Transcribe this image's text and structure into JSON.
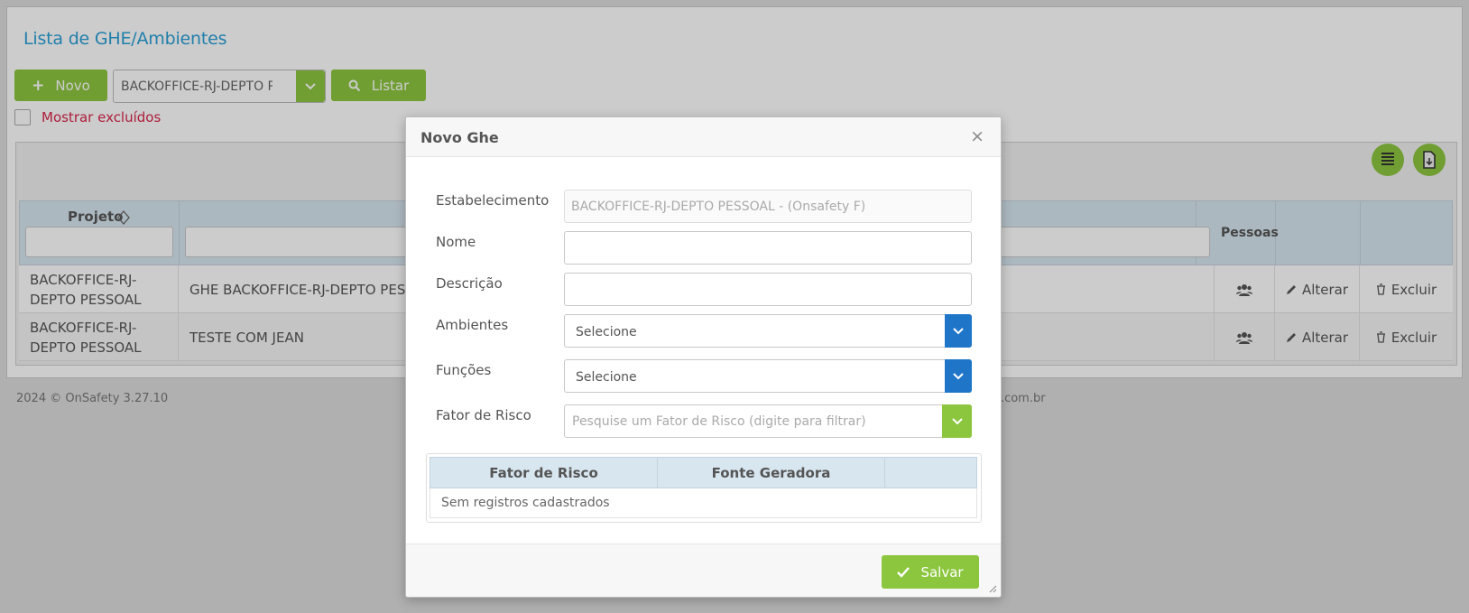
{
  "page": {
    "title": "Lista de GHE/Ambientes",
    "new_label": "Novo",
    "establishment_value": "BACKOFFICE-RJ-DEPTO PESSOAL",
    "list_label": "Listar",
    "show_deleted_label": "Mostrar excluídos",
    "icons": [
      "list-icon",
      "export-file-icon"
    ]
  },
  "grid": {
    "headers": {
      "projeto": "Projeto",
      "pessoas": "Pessoas"
    },
    "rows": [
      {
        "projeto_line1": "BACKOFFICE-RJ-",
        "projeto_line2": "DEPTO PESSOAL",
        "nome": "GHE BACKOFFICE-RJ-DEPTO PESSOAL",
        "alterar": "Alterar",
        "excluir": "Excluir"
      },
      {
        "projeto_line1": "BACKOFFICE-RJ-",
        "projeto_line2": "DEPTO PESSOAL",
        "nome": "TESTE COM JEAN",
        "alterar": "Alterar",
        "excluir": "Excluir"
      }
    ]
  },
  "footer": {
    "left": "2024 © OnSafety 3.27.10",
    "right": "ety.com.br"
  },
  "modal": {
    "title": "Novo Ghe",
    "close": "×",
    "fields": {
      "estabelecimento_label": "Estabelecimento",
      "estabelecimento_value": "BACKOFFICE-RJ-DEPTO PESSOAL - (Onsafety F)",
      "nome_label": "Nome",
      "nome_value": "",
      "descricao_label": "Descrição",
      "descricao_value": "",
      "ambientes_label": "Ambientes",
      "ambientes_value": "Selecione",
      "funcoes_label": "Funções",
      "funcoes_value": "Selecione",
      "fator_label": "Fator de Risco",
      "fator_placeholder": "Pesquise um Fator de Risco (digite para filtrar)"
    },
    "risk_table": {
      "col1": "Fator de Risco",
      "col2": "Fonte Geradora",
      "empty": "Sem registros cadastrados"
    },
    "save_label": "Salvar"
  },
  "colors": {
    "accent_green": "#8cc63f",
    "select_blue": "#1f76c9",
    "title_blue": "#2a9fd6",
    "danger_red": "#d9254a"
  }
}
